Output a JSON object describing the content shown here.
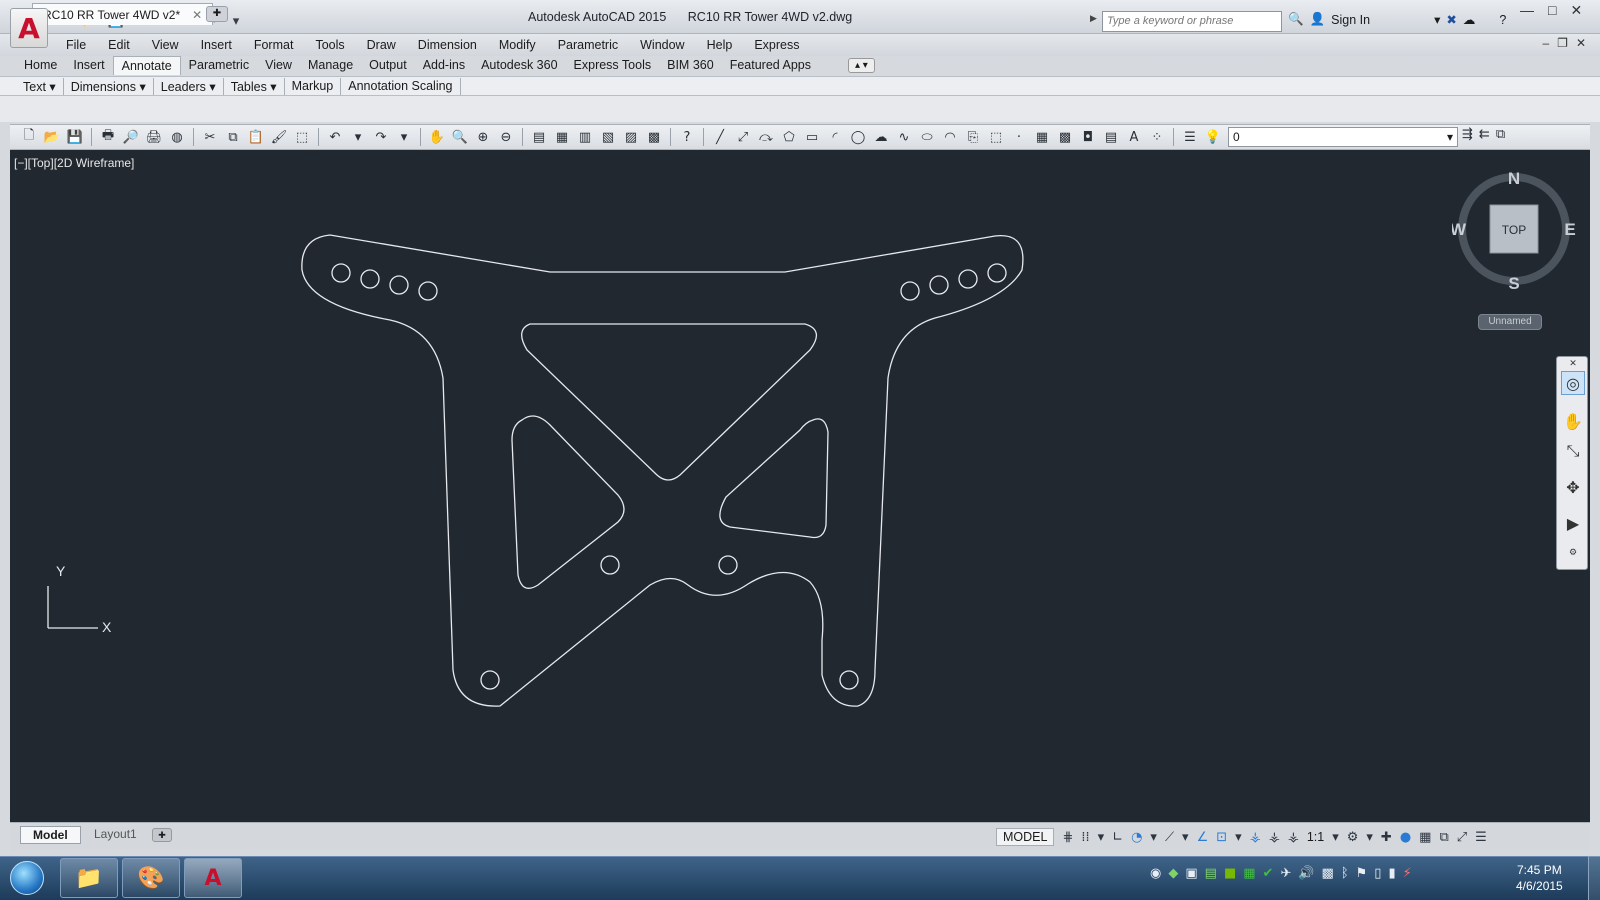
{
  "titlebar": {
    "app_name": "Autodesk AutoCAD 2015",
    "file_name": "RC10 RR Tower 4WD v2.dwg",
    "search_placeholder": "Type a keyword or phrase",
    "sign_in": "Sign In"
  },
  "menubar": [
    "File",
    "Edit",
    "View",
    "Insert",
    "Format",
    "Tools",
    "Draw",
    "Dimension",
    "Modify",
    "Parametric",
    "Window",
    "Help",
    "Express"
  ],
  "ribbon_tabs": [
    {
      "label": "Home",
      "active": false
    },
    {
      "label": "Insert",
      "active": false
    },
    {
      "label": "Annotate",
      "active": true
    },
    {
      "label": "Parametric",
      "active": false
    },
    {
      "label": "View",
      "active": false
    },
    {
      "label": "Manage",
      "active": false
    },
    {
      "label": "Output",
      "active": false
    },
    {
      "label": "Add-ins",
      "active": false
    },
    {
      "label": "Autodesk 360",
      "active": false
    },
    {
      "label": "Express Tools",
      "active": false
    },
    {
      "label": "BIM 360",
      "active": false
    },
    {
      "label": "Featured Apps",
      "active": false
    }
  ],
  "panels": [
    "Text",
    "Dimensions",
    "Leaders",
    "Tables",
    "Markup",
    "Annotation Scaling"
  ],
  "document_tab": {
    "label": "RC10 RR Tower 4WD v2*"
  },
  "layer": {
    "current": "0"
  },
  "viewport": {
    "label": "[−][Top][2D Wireframe]"
  },
  "viewcube": {
    "north": "N",
    "south": "S",
    "east": "E",
    "west": "W",
    "face": "TOP",
    "ucs_name": "Unnamed"
  },
  "ucs": {
    "x": "X",
    "y": "Y"
  },
  "layout_tabs": {
    "model": "Model",
    "layout1": "Layout1"
  },
  "statusbar": {
    "space": "MODEL",
    "scale": "1:1"
  },
  "clock": {
    "time": "7:45 PM",
    "date": "4/6/2015"
  },
  "colors": {
    "drawing_bg": "#212830",
    "linework": "#e6e9ee",
    "app_red": "#c8102e"
  }
}
